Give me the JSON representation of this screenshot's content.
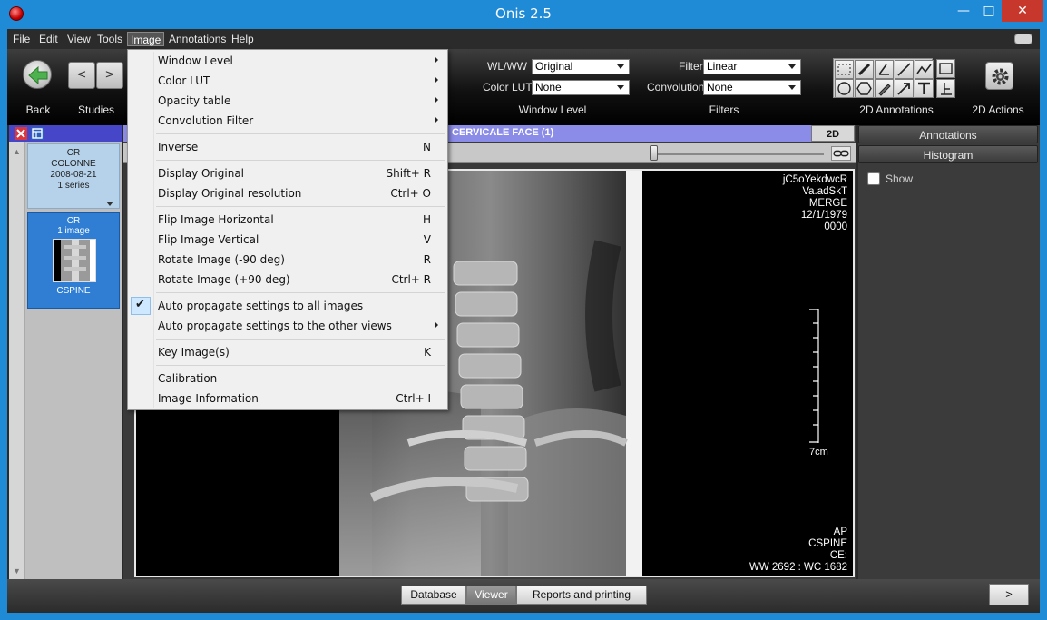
{
  "window": {
    "title": "Onis 2.5",
    "minimize": "—",
    "maximize": "□",
    "close": "✕"
  },
  "menubar": {
    "file": "File",
    "edit": "Edit",
    "view": "View",
    "tools": "Tools",
    "image": "Image",
    "annotations": "Annotations",
    "help": "Help"
  },
  "toolbar": {
    "back_label": "Back",
    "studies_label": "Studies",
    "prev": "<",
    "next": ">",
    "wlww_label": "WL/WW",
    "wlww_value": "Original",
    "colorlut_label": "Color LUT",
    "colorlut_value": "None",
    "filter_label": "Filter",
    "filter_value": "Linear",
    "convolution_label": "Convolution",
    "convolution_value": "None",
    "window_level_group": "Window Level",
    "filters_group": "Filters",
    "annotations_group": "2D Annotations",
    "actions_group": "2D Actions"
  },
  "series": [
    {
      "modality": "CR",
      "name": "COLONNE",
      "date": "2008-08-21",
      "count": "1 series"
    },
    {
      "modality": "CR",
      "count": "1 image",
      "name": "CSPINE"
    }
  ],
  "viewer": {
    "header_title": "CERVICALE FACE (1)",
    "mode": "2D",
    "overlay_top_right": [
      "jC5oYekdwcR",
      "Va.adSkT",
      "MERGE",
      "12/1/1979",
      "0000"
    ],
    "overlay_bottom_right": [
      "AP",
      "CSPINE",
      "CE:",
      "WW 2692 : WC 1682"
    ],
    "ruler_label": "7cm"
  },
  "right_panel": {
    "annotations_tab": "Annotations",
    "histogram_tab": "Histogram",
    "show_label": "Show"
  },
  "bottom": {
    "database": "Database",
    "viewer": "Viewer",
    "reports": "Reports and printing",
    "next": ">"
  },
  "image_menu": [
    {
      "label": "Window Level",
      "submenu": true
    },
    {
      "label": "Color LUT",
      "submenu": true
    },
    {
      "label": "Opacity table",
      "submenu": true
    },
    {
      "label": "Convolution Filter",
      "submenu": true
    },
    {
      "label": "Inverse",
      "shortcut": "N"
    },
    {
      "label": "Display Original",
      "shortcut": "Shift+ R"
    },
    {
      "label": "Display Original resolution",
      "shortcut": "Ctrl+ O"
    },
    {
      "label": "Flip Image Horizontal",
      "shortcut": "H"
    },
    {
      "label": "Flip Image Vertical",
      "shortcut": "V"
    },
    {
      "label": "Rotate Image (-90 deg)",
      "shortcut": "R"
    },
    {
      "label": "Rotate Image (+90 deg)",
      "shortcut": "Ctrl+ R"
    },
    {
      "label": "Auto propagate settings to all images",
      "checked": true,
      "check_glyph": "✔"
    },
    {
      "label": "Auto propagate settings to the other views",
      "submenu": true
    },
    {
      "label": "Key Image(s)",
      "shortcut": "K"
    },
    {
      "label": "Calibration"
    },
    {
      "label": "Image Information",
      "shortcut": "Ctrl+ I"
    }
  ],
  "colors": {
    "title_bar": "#1f8ad6",
    "close_button": "#c7372c",
    "series_header": "#4646c8",
    "viewer_header": "#8b8be8",
    "selected_series": "#2f7ed3",
    "back_arrow": "#4db24d"
  }
}
